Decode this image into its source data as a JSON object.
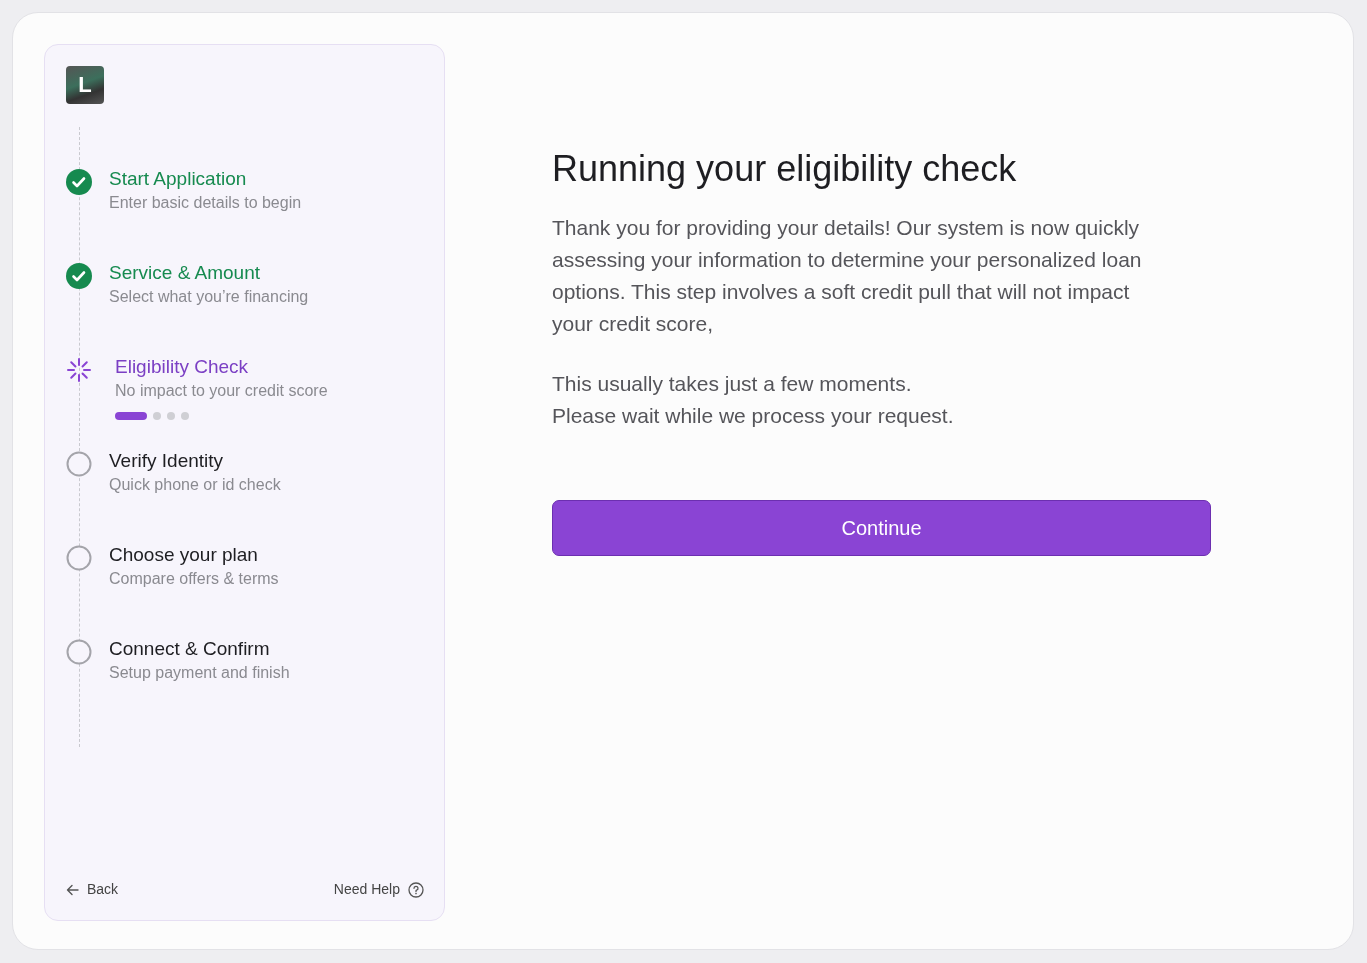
{
  "logo": {
    "letter": "L"
  },
  "steps": [
    {
      "title": "Start Application",
      "subtitle": "Enter basic details to begin",
      "completed": true,
      "selected": false
    },
    {
      "title": "Service & Amount",
      "subtitle": "Select what you’re financing",
      "completed": true,
      "selected": false
    },
    {
      "title": "Eligibility Check",
      "subtitle": "No impact to your credit score",
      "completed": false,
      "selected": true
    },
    {
      "title": "Verify Identity",
      "subtitle": "Quick phone or id check",
      "completed": false,
      "selected": false
    },
    {
      "title": "Choose your plan",
      "subtitle": "Compare offers & terms",
      "completed": false,
      "selected": false
    },
    {
      "title": "Connect & Confirm",
      "subtitle": "Setup payment and finish",
      "completed": false,
      "selected": false
    }
  ],
  "footer": {
    "back": "Back",
    "help": "Need Help"
  },
  "main": {
    "heading": "Running your eligibility check",
    "paragraphs": [
      "Thank you for providing your details! Our system is now quickly assessing your information to determine your personalized loan options. This step involves a soft credit pull that will not impact your credit score,",
      "This usually takes just a few moments.\nPlease wait while we process your request."
    ],
    "button": "Continue"
  }
}
